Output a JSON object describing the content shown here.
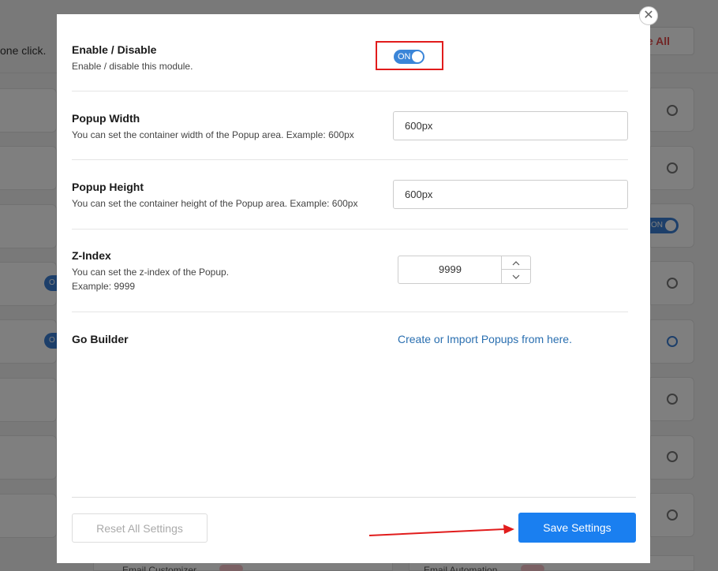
{
  "background": {
    "intro_text": "one click.",
    "top_button_label": "e All",
    "bottom_items": [
      "Email Customizer",
      "Email Automation"
    ]
  },
  "modal": {
    "close_symbol": "✕",
    "enable": {
      "title": "Enable / Disable",
      "description": "Enable / disable this module.",
      "toggle_label": "ON",
      "enabled": true
    },
    "popup_width": {
      "title": "Popup Width",
      "description": "You can set the container width of the Popup area. Example: 600px",
      "value": "600px"
    },
    "popup_height": {
      "title": "Popup Height",
      "description": "You can set the container height of the Popup area. Example: 600px",
      "value": "600px"
    },
    "z_index": {
      "title": "Z-Index",
      "description_line1": "You can set the z-index of the Popup.",
      "description_line2": "Example: 9999",
      "value": "9999",
      "up_symbol": "^",
      "down_symbol": "v"
    },
    "go_builder": {
      "title": "Go Builder",
      "link_text": "Create or Import Popups from here."
    },
    "footer": {
      "reset_label": "Reset All Settings",
      "save_label": "Save Settings"
    }
  },
  "colors": {
    "primary": "#1a7ff0",
    "toggle_on": "#3a85d8",
    "link": "#2a6fb0",
    "highlight": "#e11c1c"
  }
}
